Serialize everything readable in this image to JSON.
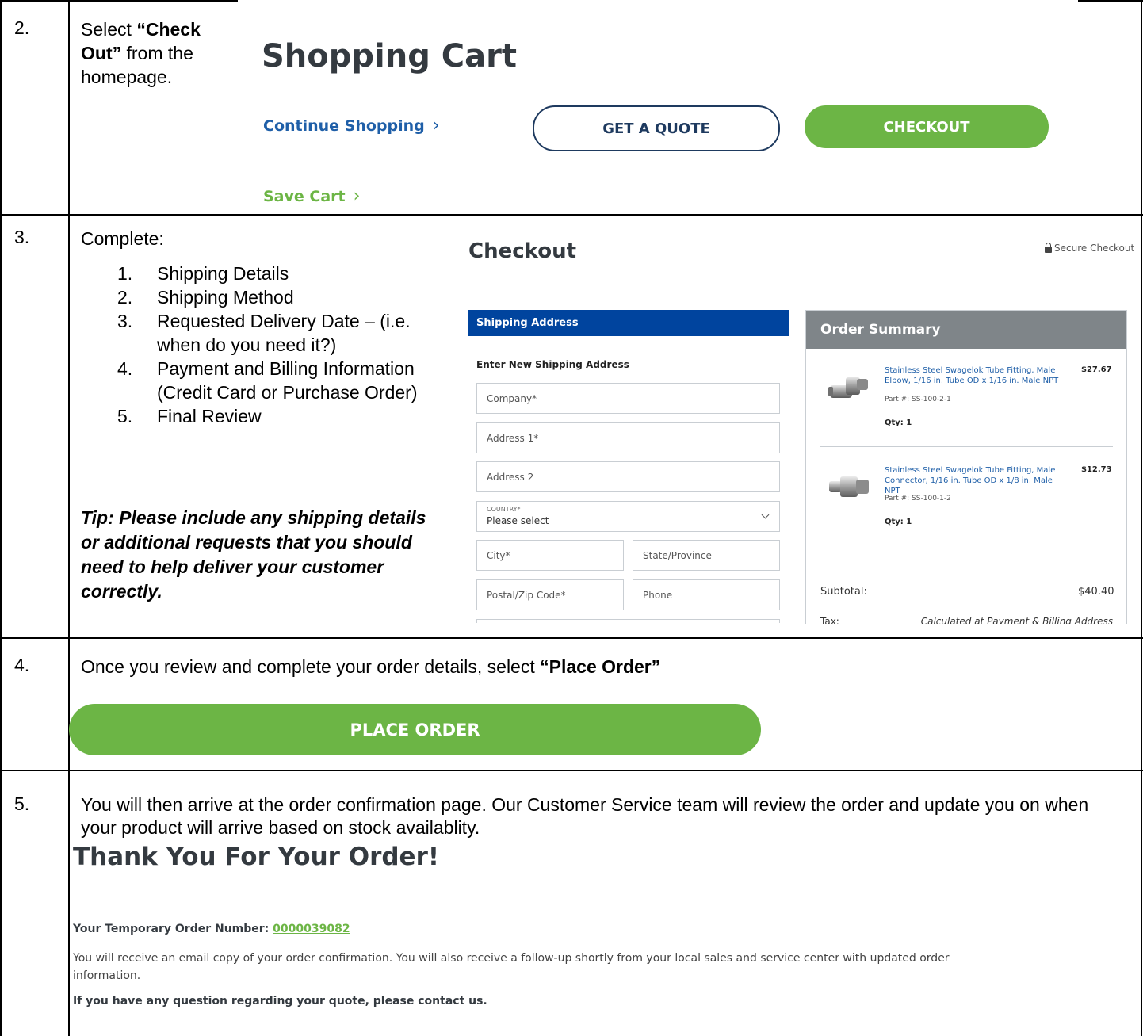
{
  "rows": [
    {
      "num": "2."
    },
    {
      "num": "3."
    },
    {
      "num": "4."
    },
    {
      "num": "5."
    }
  ],
  "step2": {
    "instr_pre": "Select ",
    "instr_bold": "“Check Out”",
    "instr_post": " from the homepage.",
    "cart_title": "Shopping Cart",
    "continue_label": "Continue Shopping",
    "quote_label": "GET A QUOTE",
    "checkout_label": "CHECKOUT",
    "save_label": "Save Cart"
  },
  "step3": {
    "intro": "Complete:",
    "items": [
      {
        "n": "1.",
        "text": "Shipping Details"
      },
      {
        "n": "2.",
        "text": "Shipping Method"
      },
      {
        "n": "3.",
        "text": "Requested Delivery Date – (i.e. when do you need it?)"
      },
      {
        "n": "4.",
        "text": "Payment and Billing Information (Credit Card or Purchase Order)"
      },
      {
        "n": "5.",
        "text": "Final Review"
      }
    ],
    "tip": "Tip: Please include any shipping details or additional requests that you should need to help deliver your customer correctly.",
    "checkout_title": "Checkout",
    "secure_label": "Secure Checkout",
    "ship_header": "Shipping Address",
    "enter_new": "Enter New Shipping Address",
    "ph_company": "Company*",
    "ph_address1": "Address 1*",
    "ph_address2": "Address 2",
    "country_label": "COUNTRY*",
    "country_value": "Please select",
    "ph_city": "City*",
    "ph_state": "State/Province",
    "ph_postal": "Postal/Zip Code*",
    "ph_phone": "Phone",
    "summary_header": "Order Summary",
    "products": [
      {
        "name": "Stainless Steel Swagelok Tube Fitting, Male Elbow, 1/16 in. Tube OD x 1/16 in. Male NPT",
        "price": "$27.67",
        "part": "Part #: SS-100-2-1",
        "qty": "Qty: 1"
      },
      {
        "name": "Stainless Steel Swagelok Tube Fitting, Male Connector, 1/16 in. Tube OD x 1/8 in. Male NPT",
        "price": "$12.73",
        "part": "Part #: SS-100-1-2",
        "qty": "Qty: 1"
      }
    ],
    "subtotal_label": "Subtotal:",
    "subtotal_value": "$40.40",
    "tax_label": "Tax:",
    "tax_value": "Calculated at Payment & Billing Address"
  },
  "step4": {
    "instr_pre": "Once you review and complete your order details, select ",
    "instr_bold": "“Place Order”",
    "place_label": "PLACE ORDER"
  },
  "step5": {
    "instr": "You will then arrive at the order confirmation page. Our Customer Service team will review the order and update you on when your product will arrive based on stock availablity.",
    "thanks_title": "Thank You For Your Order!",
    "temp_label": "Your Temporary Order Number: ",
    "order_number": "0000039082",
    "email_note": "You will receive an email copy of your order confirmation. You will also receive a follow-up shortly from your local sales and service center with updated order information.",
    "question_note": "If you have any question regarding your quote, please contact us."
  },
  "colors": {
    "green": "#6cb545",
    "blue_header": "#00449e",
    "link_blue": "#1f5fa8",
    "title_dark": "#343a40",
    "summary_gray": "#7f8589"
  }
}
